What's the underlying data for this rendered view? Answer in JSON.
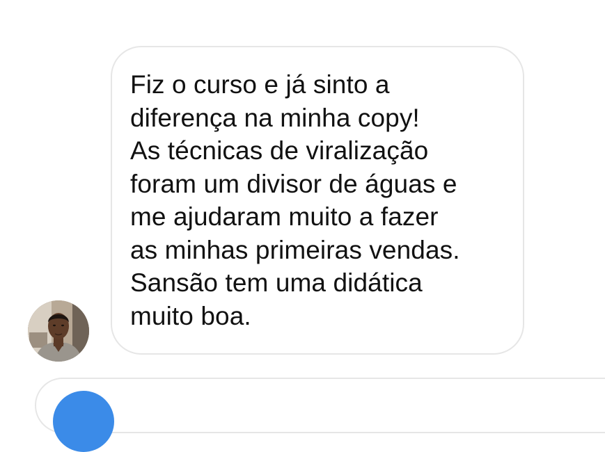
{
  "message": {
    "text": "Fiz o curso e já sinto a\ndiferença na minha copy!\nAs técnicas de viralização\nforam um divisor de águas e\nme ajudaram muito a fazer\nas minhas primeiras vendas.\nSansão tem uma didática\nmuito boa.",
    "avatar_icon": "user-photo",
    "bubble_border_color": "#e6e6e6",
    "text_color": "#111111"
  },
  "next_message": {
    "avatar_color": "#3b8be8"
  }
}
